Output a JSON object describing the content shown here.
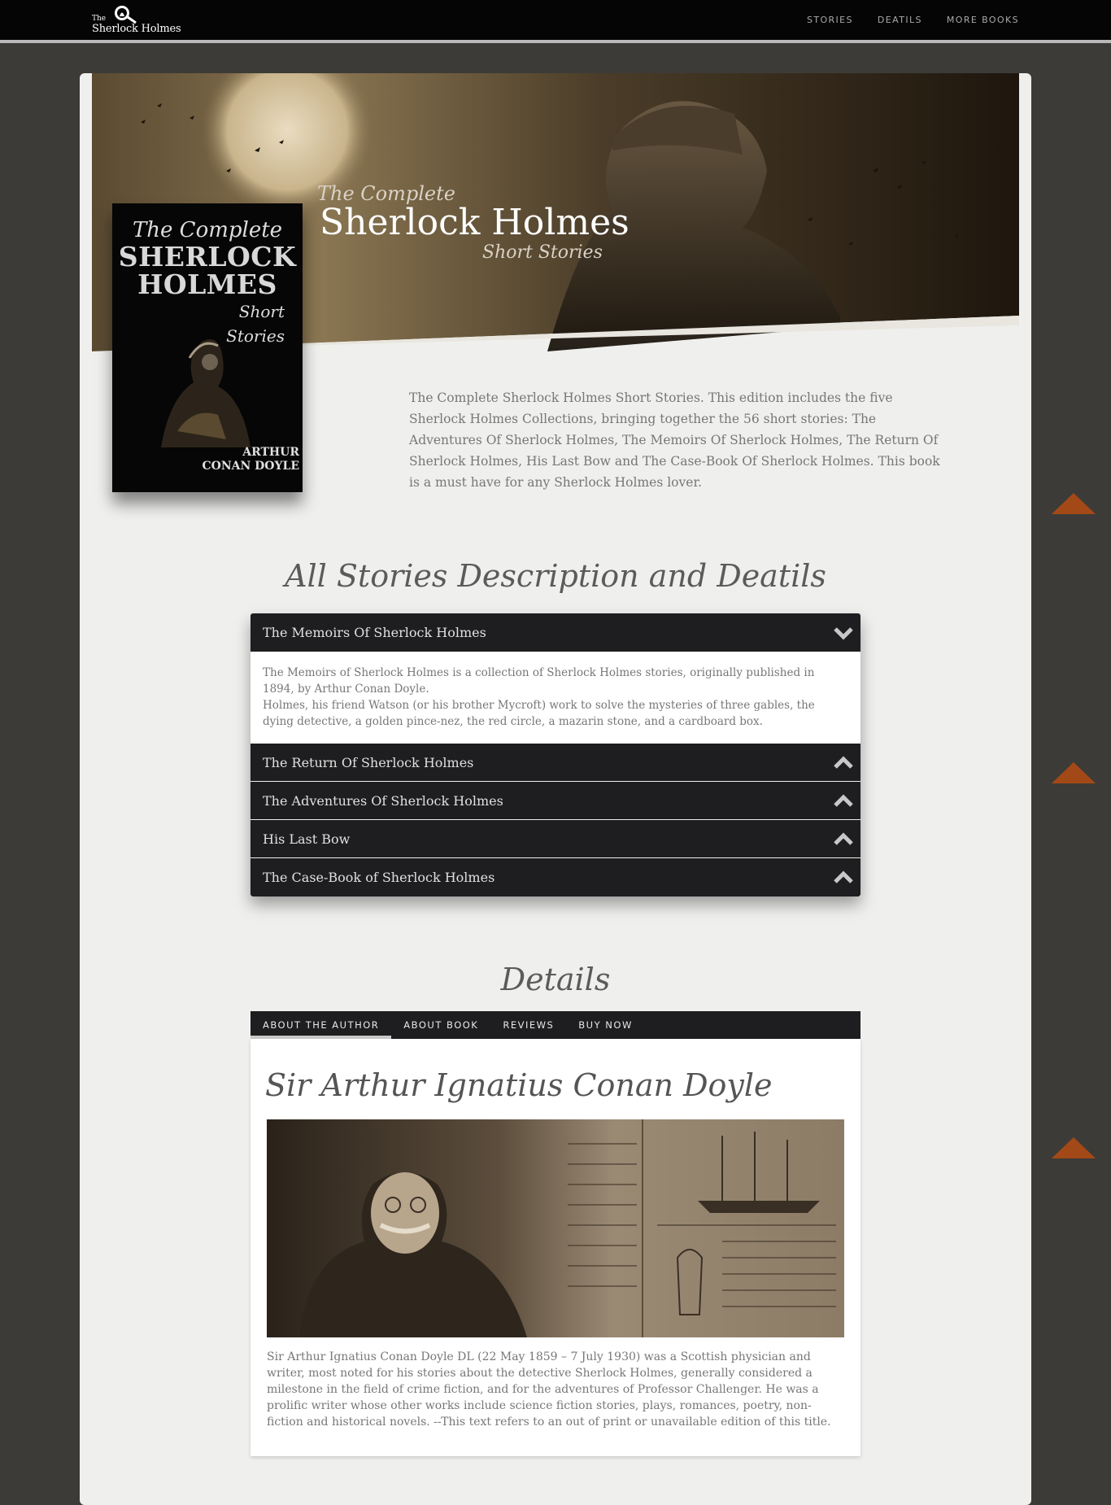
{
  "brand": {
    "the": "The",
    "name": "Sherlock Holmes"
  },
  "nav": {
    "items": [
      "STORIES",
      "DEATILS",
      "MORE BOOKS"
    ]
  },
  "hero": {
    "kicker": "The Complete",
    "title": "Sherlock Holmes",
    "subtitle": "Short Stories"
  },
  "cover": {
    "top": "The Complete",
    "line1": "SHERLOCK",
    "line2": "HOLMES",
    "short": "Short Stories",
    "author1": "ARTHUR",
    "author2": "CONAN DOYLE"
  },
  "intro": "The Complete Sherlock Holmes Short Stories. This edition includes the five Sherlock Holmes Collections, bringing together the 56 short stories: The Adventures Of Sherlock Holmes, The Memoirs Of Sherlock Holmes, The Return Of Sherlock Holmes, His Last Bow and The Case-Book Of Sherlock Holmes. This book is a must have for any Sherlock Holmes lover.",
  "stories_title": "All Stories Description and Deatils",
  "accordion": {
    "open": {
      "title": "The Memoirs Of Sherlock Holmes",
      "para1": "The Memoirs of Sherlock Holmes is a collection of Sherlock Holmes stories, originally published in 1894, by Arthur Conan Doyle.",
      "para2": "Holmes, his friend Watson (or his brother Mycroft) work to solve the mysteries of three gables, the dying detective, a golden pince-nez, the red circle, a mazarin stone, and a cardboard box."
    },
    "closed": [
      "The Return Of Sherlock Holmes",
      "The Adventures Of Sherlock Holmes",
      "His Last Bow",
      "The Case-Book of Sherlock Holmes"
    ]
  },
  "details_title": "Details",
  "tabs": [
    "ABOUT THE AUTHOR",
    "ABOUT BOOK",
    "REVIEWS",
    "BUY NOW"
  ],
  "author": {
    "name": "Sir Arthur Ignatius Conan Doyle",
    "bio": "Sir Arthur Ignatius Conan Doyle DL (22 May 1859 – 7 July 1930) was a Scottish physician and writer, most noted for his stories about the detective Sherlock Holmes, generally considered a milestone in the field of crime fiction, and for the adventures of Professor Challenger. He was a prolific writer whose other works include science fiction stories, plays, romances, poetry, non-fiction and historical novels. --This text refers to an out of print or unavailable edition of this title."
  },
  "colors": {
    "accent_arrow": "#a34917",
    "dark_bar": "#1e1e20",
    "page_bg": "#3d3b37",
    "panel_bg": "#efefed"
  },
  "icons": [
    "magnifier-logo-icon",
    "chevron-down-icon",
    "chevron-up-icon",
    "triangle-up-icon"
  ]
}
